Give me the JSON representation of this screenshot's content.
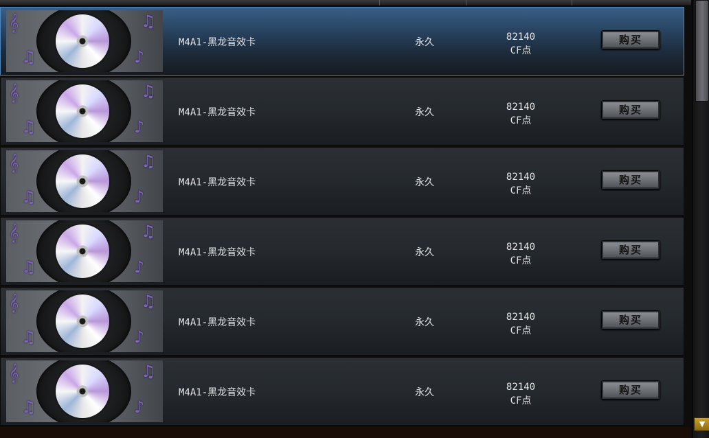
{
  "items": [
    {
      "name": "M4A1-黑龙音效卡",
      "duration": "永久",
      "price": "82140",
      "currency": "CF点",
      "buy_label": "购买",
      "selected": true
    },
    {
      "name": "M4A1-黑龙音效卡",
      "duration": "永久",
      "price": "82140",
      "currency": "CF点",
      "buy_label": "购买",
      "selected": false
    },
    {
      "name": "M4A1-黑龙音效卡",
      "duration": "永久",
      "price": "82140",
      "currency": "CF点",
      "buy_label": "购买",
      "selected": false
    },
    {
      "name": "M4A1-黑龙音效卡",
      "duration": "永久",
      "price": "82140",
      "currency": "CF点",
      "buy_label": "购买",
      "selected": false
    },
    {
      "name": "M4A1-黑龙音效卡",
      "duration": "永久",
      "price": "82140",
      "currency": "CF点",
      "buy_label": "购买",
      "selected": false
    },
    {
      "name": "M4A1-黑龙音效卡",
      "duration": "永久",
      "price": "82140",
      "currency": "CF点",
      "buy_label": "购买",
      "selected": false
    }
  ],
  "thumbnail_icon": "music-disc-icon",
  "colors": {
    "selected_row_accent": "#4d87c2",
    "row_background": "#252a2f",
    "scroll_arrow": "#c9a02a"
  }
}
